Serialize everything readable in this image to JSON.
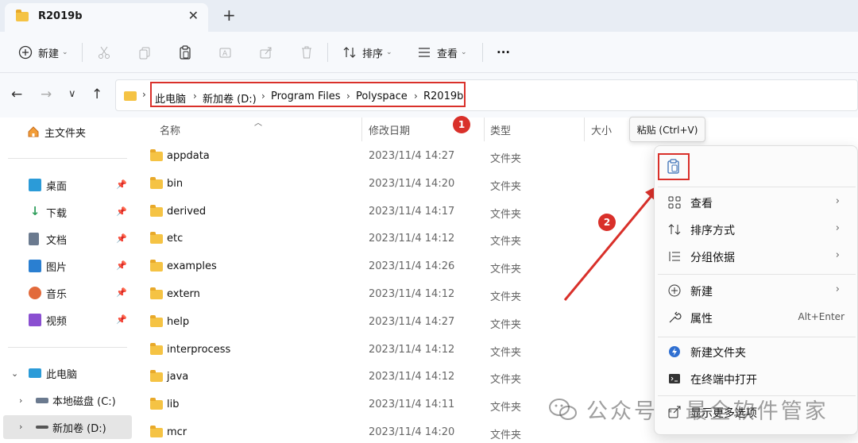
{
  "tab": {
    "title": "R2019b",
    "close": "✕",
    "add": "+"
  },
  "toolbar": {
    "new_label": "新建",
    "sort_label": "排序",
    "view_label": "查看",
    "more": "···"
  },
  "nav": {
    "back": "←",
    "forward": "→",
    "recent": "∨",
    "up": "↑"
  },
  "breadcrumb": {
    "items": [
      "此电脑",
      "新加卷 (D:)",
      "Program Files",
      "Polyspace",
      "R2019b"
    ],
    "separator": "›"
  },
  "sidebar": {
    "home": "主文件夹",
    "quick": [
      {
        "label": "桌面",
        "icon": "desktop-icon",
        "color": "#2b9bd8"
      },
      {
        "label": "下载",
        "icon": "download-icon",
        "color": "#2f9e5b"
      },
      {
        "label": "文档",
        "icon": "document-icon",
        "color": "#6b7a8f"
      },
      {
        "label": "图片",
        "icon": "picture-icon",
        "color": "#2a7fd1"
      },
      {
        "label": "音乐",
        "icon": "music-icon",
        "color": "#e26a3b"
      },
      {
        "label": "视频",
        "icon": "video-icon",
        "color": "#8a4fd1"
      }
    ],
    "this_pc": "此电脑",
    "drives": [
      "本地磁盘 (C:)",
      "新加卷 (D:)"
    ]
  },
  "columns": {
    "name": "名称",
    "date": "修改日期",
    "type": "类型",
    "size": "大小"
  },
  "files": [
    {
      "name": "appdata",
      "date": "2023/11/4 14:27",
      "type": "文件夹"
    },
    {
      "name": "bin",
      "date": "2023/11/4 14:20",
      "type": "文件夹"
    },
    {
      "name": "derived",
      "date": "2023/11/4 14:17",
      "type": "文件夹"
    },
    {
      "name": "etc",
      "date": "2023/11/4 14:12",
      "type": "文件夹"
    },
    {
      "name": "examples",
      "date": "2023/11/4 14:26",
      "type": "文件夹"
    },
    {
      "name": "extern",
      "date": "2023/11/4 14:12",
      "type": "文件夹"
    },
    {
      "name": "help",
      "date": "2023/11/4 14:27",
      "type": "文件夹"
    },
    {
      "name": "interprocess",
      "date": "2023/11/4 14:12",
      "type": "文件夹"
    },
    {
      "name": "java",
      "date": "2023/11/4 14:12",
      "type": "文件夹"
    },
    {
      "name": "lib",
      "date": "2023/11/4 14:11",
      "type": "文件夹"
    },
    {
      "name": "mcr",
      "date": "2023/11/4 14:20",
      "type": "文件夹"
    }
  ],
  "tooltip": "粘贴 (Ctrl+V)",
  "context_menu": {
    "view": "查看",
    "sort": "排序方式",
    "group": "分组依据",
    "new": "新建",
    "properties": "属性",
    "properties_shortcut": "Alt+Enter",
    "new_folder": "新建文件夹",
    "open_terminal": "在终端中打开",
    "more_options": "显示更多选项",
    "arrow": "›"
  },
  "annotations": {
    "step1": "1",
    "step2": "2",
    "color": "#d9302a"
  },
  "watermark": {
    "text": "公众号 · 最全软件管家"
  }
}
